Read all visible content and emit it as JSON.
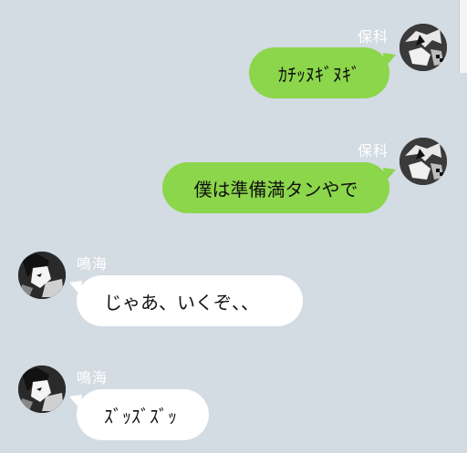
{
  "messages": [
    {
      "sender": "保科",
      "text": "ｶﾁｯﾇｷﾞﾇｷﾞ",
      "side": "right",
      "avatar_icon": "manga-character-avatar"
    },
    {
      "sender": "保科",
      "text": "僕は準備満タンやで",
      "side": "right",
      "avatar_icon": "manga-character-avatar"
    },
    {
      "sender": "鳴海",
      "text": "じゃあ、いくぞ、、",
      "side": "left",
      "avatar_icon": "manga-character-avatar"
    },
    {
      "sender": "鳴海",
      "text": "ｽﾞｯｽﾞｽﾞｯ",
      "side": "left",
      "avatar_icon": "manga-character-avatar"
    }
  ],
  "colors": {
    "background": "#d3dbe3",
    "my_bubble": "#8bd64a",
    "their_bubble": "#ffffff",
    "name_text": "#ffffff"
  }
}
